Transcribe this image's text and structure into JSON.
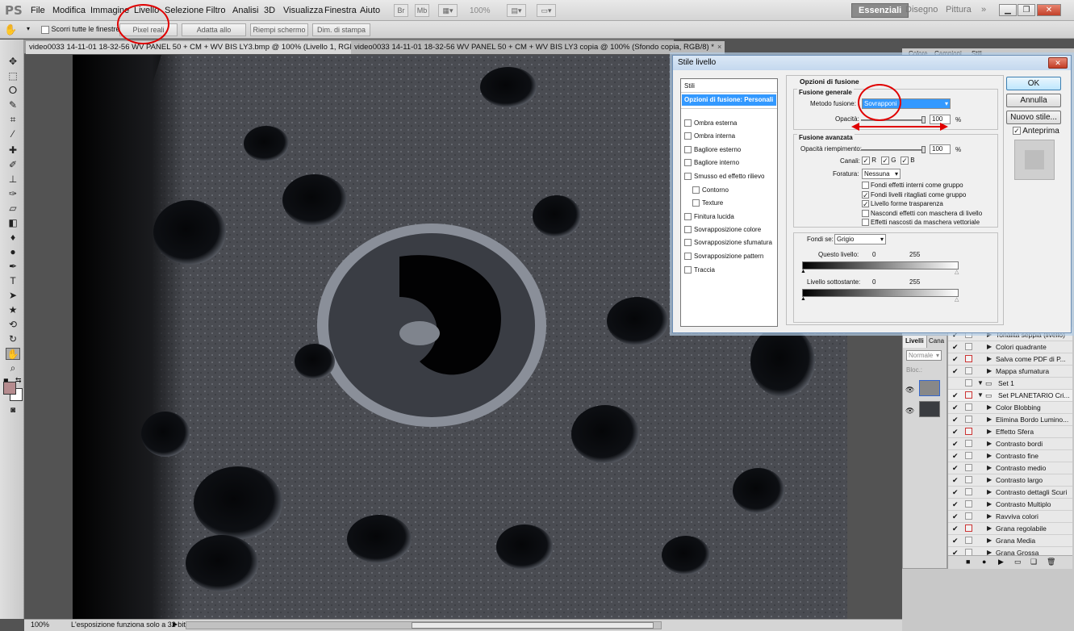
{
  "app": {
    "logo": "PS"
  },
  "menu": [
    "File",
    "Modifica",
    "Immagine",
    "Livello",
    "Selezione",
    "Filtro",
    "Analisi",
    "3D",
    "Visualizza",
    "Finestra",
    "Aiuto"
  ],
  "toolbar": {
    "zoom": "100%"
  },
  "workspaces": {
    "active": "Essenziali",
    "items": [
      "Disegno",
      "Pittura"
    ],
    "more": "»"
  },
  "options_bar": {
    "scroll_all": "Scorri tutte le finestre",
    "buttons": [
      "Pixel reali",
      "Adatta allo schermo",
      "Riempi schermo",
      "Dim. di stampa"
    ]
  },
  "tabs": [
    {
      "label": "video0033 14-11-01 18-32-56 WV PANEL 50 + CM + WV BIS LY3.bmp @ 100% (Livello 1, RGB/8) *",
      "close": "×"
    },
    {
      "label": "video0033 14-11-01 18-32-56 WV PANEL 50 + CM + WV BIS LY3 copia @ 100% (Sfondo copia, RGB/8) *",
      "close": "×"
    }
  ],
  "status": {
    "zoom": "100%",
    "message": "L'esposizione funziona solo a 32 bit"
  },
  "panels": {
    "top_tabs": [
      "Colore",
      "Campioni",
      "Stili"
    ],
    "layers": {
      "tab": "Livelli",
      "tab2": "Cana",
      "blend": "Normale",
      "lock": "Bloc.:"
    }
  },
  "actions": [
    {
      "label": "Tonalità seppia (livello)",
      "checked": true,
      "dialog": false,
      "kind": "action"
    },
    {
      "label": "Colori quadrante",
      "checked": true,
      "dialog": false,
      "kind": "action"
    },
    {
      "label": "Salva come PDF di P...",
      "checked": true,
      "dialog": true,
      "kind": "action"
    },
    {
      "label": "Mappa sfumatura",
      "checked": true,
      "dialog": false,
      "kind": "action"
    },
    {
      "label": "Set 1",
      "checked": false,
      "dialog": false,
      "kind": "set"
    },
    {
      "label": "Set PLANETARIO Cri...",
      "checked": true,
      "dialog": true,
      "kind": "set"
    },
    {
      "label": "Color Blobbing",
      "checked": true,
      "dialog": false,
      "kind": "action"
    },
    {
      "label": "Elimina Bordo Lumino...",
      "checked": true,
      "dialog": false,
      "kind": "action"
    },
    {
      "label": "Effetto Sfera",
      "checked": true,
      "dialog": true,
      "kind": "action"
    },
    {
      "label": "Contrasto bordi",
      "checked": true,
      "dialog": false,
      "kind": "action"
    },
    {
      "label": "Contrasto fine",
      "checked": true,
      "dialog": false,
      "kind": "action"
    },
    {
      "label": "Contrasto medio",
      "checked": true,
      "dialog": false,
      "kind": "action"
    },
    {
      "label": "Contrasto largo",
      "checked": true,
      "dialog": false,
      "kind": "action"
    },
    {
      "label": "Contrasto dettagli Scuri",
      "checked": true,
      "dialog": false,
      "kind": "action"
    },
    {
      "label": "Contrasto Multiplo",
      "checked": true,
      "dialog": false,
      "kind": "action"
    },
    {
      "label": "Ravviva colori",
      "checked": true,
      "dialog": false,
      "kind": "action"
    },
    {
      "label": "Grana regolabile",
      "checked": true,
      "dialog": true,
      "kind": "action"
    },
    {
      "label": "Grana Media",
      "checked": true,
      "dialog": false,
      "kind": "action"
    },
    {
      "label": "Grana Grossa",
      "checked": true,
      "dialog": false,
      "kind": "action"
    }
  ],
  "dialog": {
    "title": "Stile livello",
    "close": "✕",
    "styles_header": "Stili",
    "active_style": "Opzioni di fusione: Personali",
    "styles": [
      "Ombra esterna",
      "Ombra interna",
      "Bagliore esterno",
      "Bagliore interno",
      "Smusso ed effetto rilievo",
      "Contorno",
      "Texture",
      "Finitura lucida",
      "Sovrapposizione colore",
      "Sovrapposizione sfumatura",
      "Sovrapposizione pattern",
      "Traccia"
    ],
    "section_title": "Opzioni di fusione",
    "general": {
      "title": "Fusione generale",
      "mode_label": "Metodo fusione:",
      "mode_value": "Sovrapponi",
      "opacity_label": "Opacità:",
      "opacity_value": "100",
      "unit": "%"
    },
    "advanced": {
      "title": "Fusione avanzata",
      "fill_label": "Opacità riempimento:",
      "fill_value": "100",
      "unit": "%",
      "channels_label": "Canali:",
      "channels": [
        "R",
        "G",
        "B"
      ],
      "knockout_label": "Foratura:",
      "knockout_value": "Nessuna",
      "options": [
        {
          "label": "Fondi effetti interni come gruppo",
          "checked": false
        },
        {
          "label": "Fondi livelli ritagliati come gruppo",
          "checked": true
        },
        {
          "label": "Livello forme trasparenza",
          "checked": true
        },
        {
          "label": "Nascondi effetti con maschera di livello",
          "checked": false
        },
        {
          "label": "Effetti nascosti da maschera vettoriale",
          "checked": false
        }
      ]
    },
    "blendif": {
      "label": "Fondi se:",
      "value": "Grigio",
      "this_layer": "Questo livello:",
      "underlying": "Livello sottostante:",
      "min": "0",
      "max": "255"
    },
    "buttons": {
      "ok": "OK",
      "cancel": "Annulla",
      "new_style": "Nuovo stile...",
      "preview": "Anteprima"
    }
  }
}
